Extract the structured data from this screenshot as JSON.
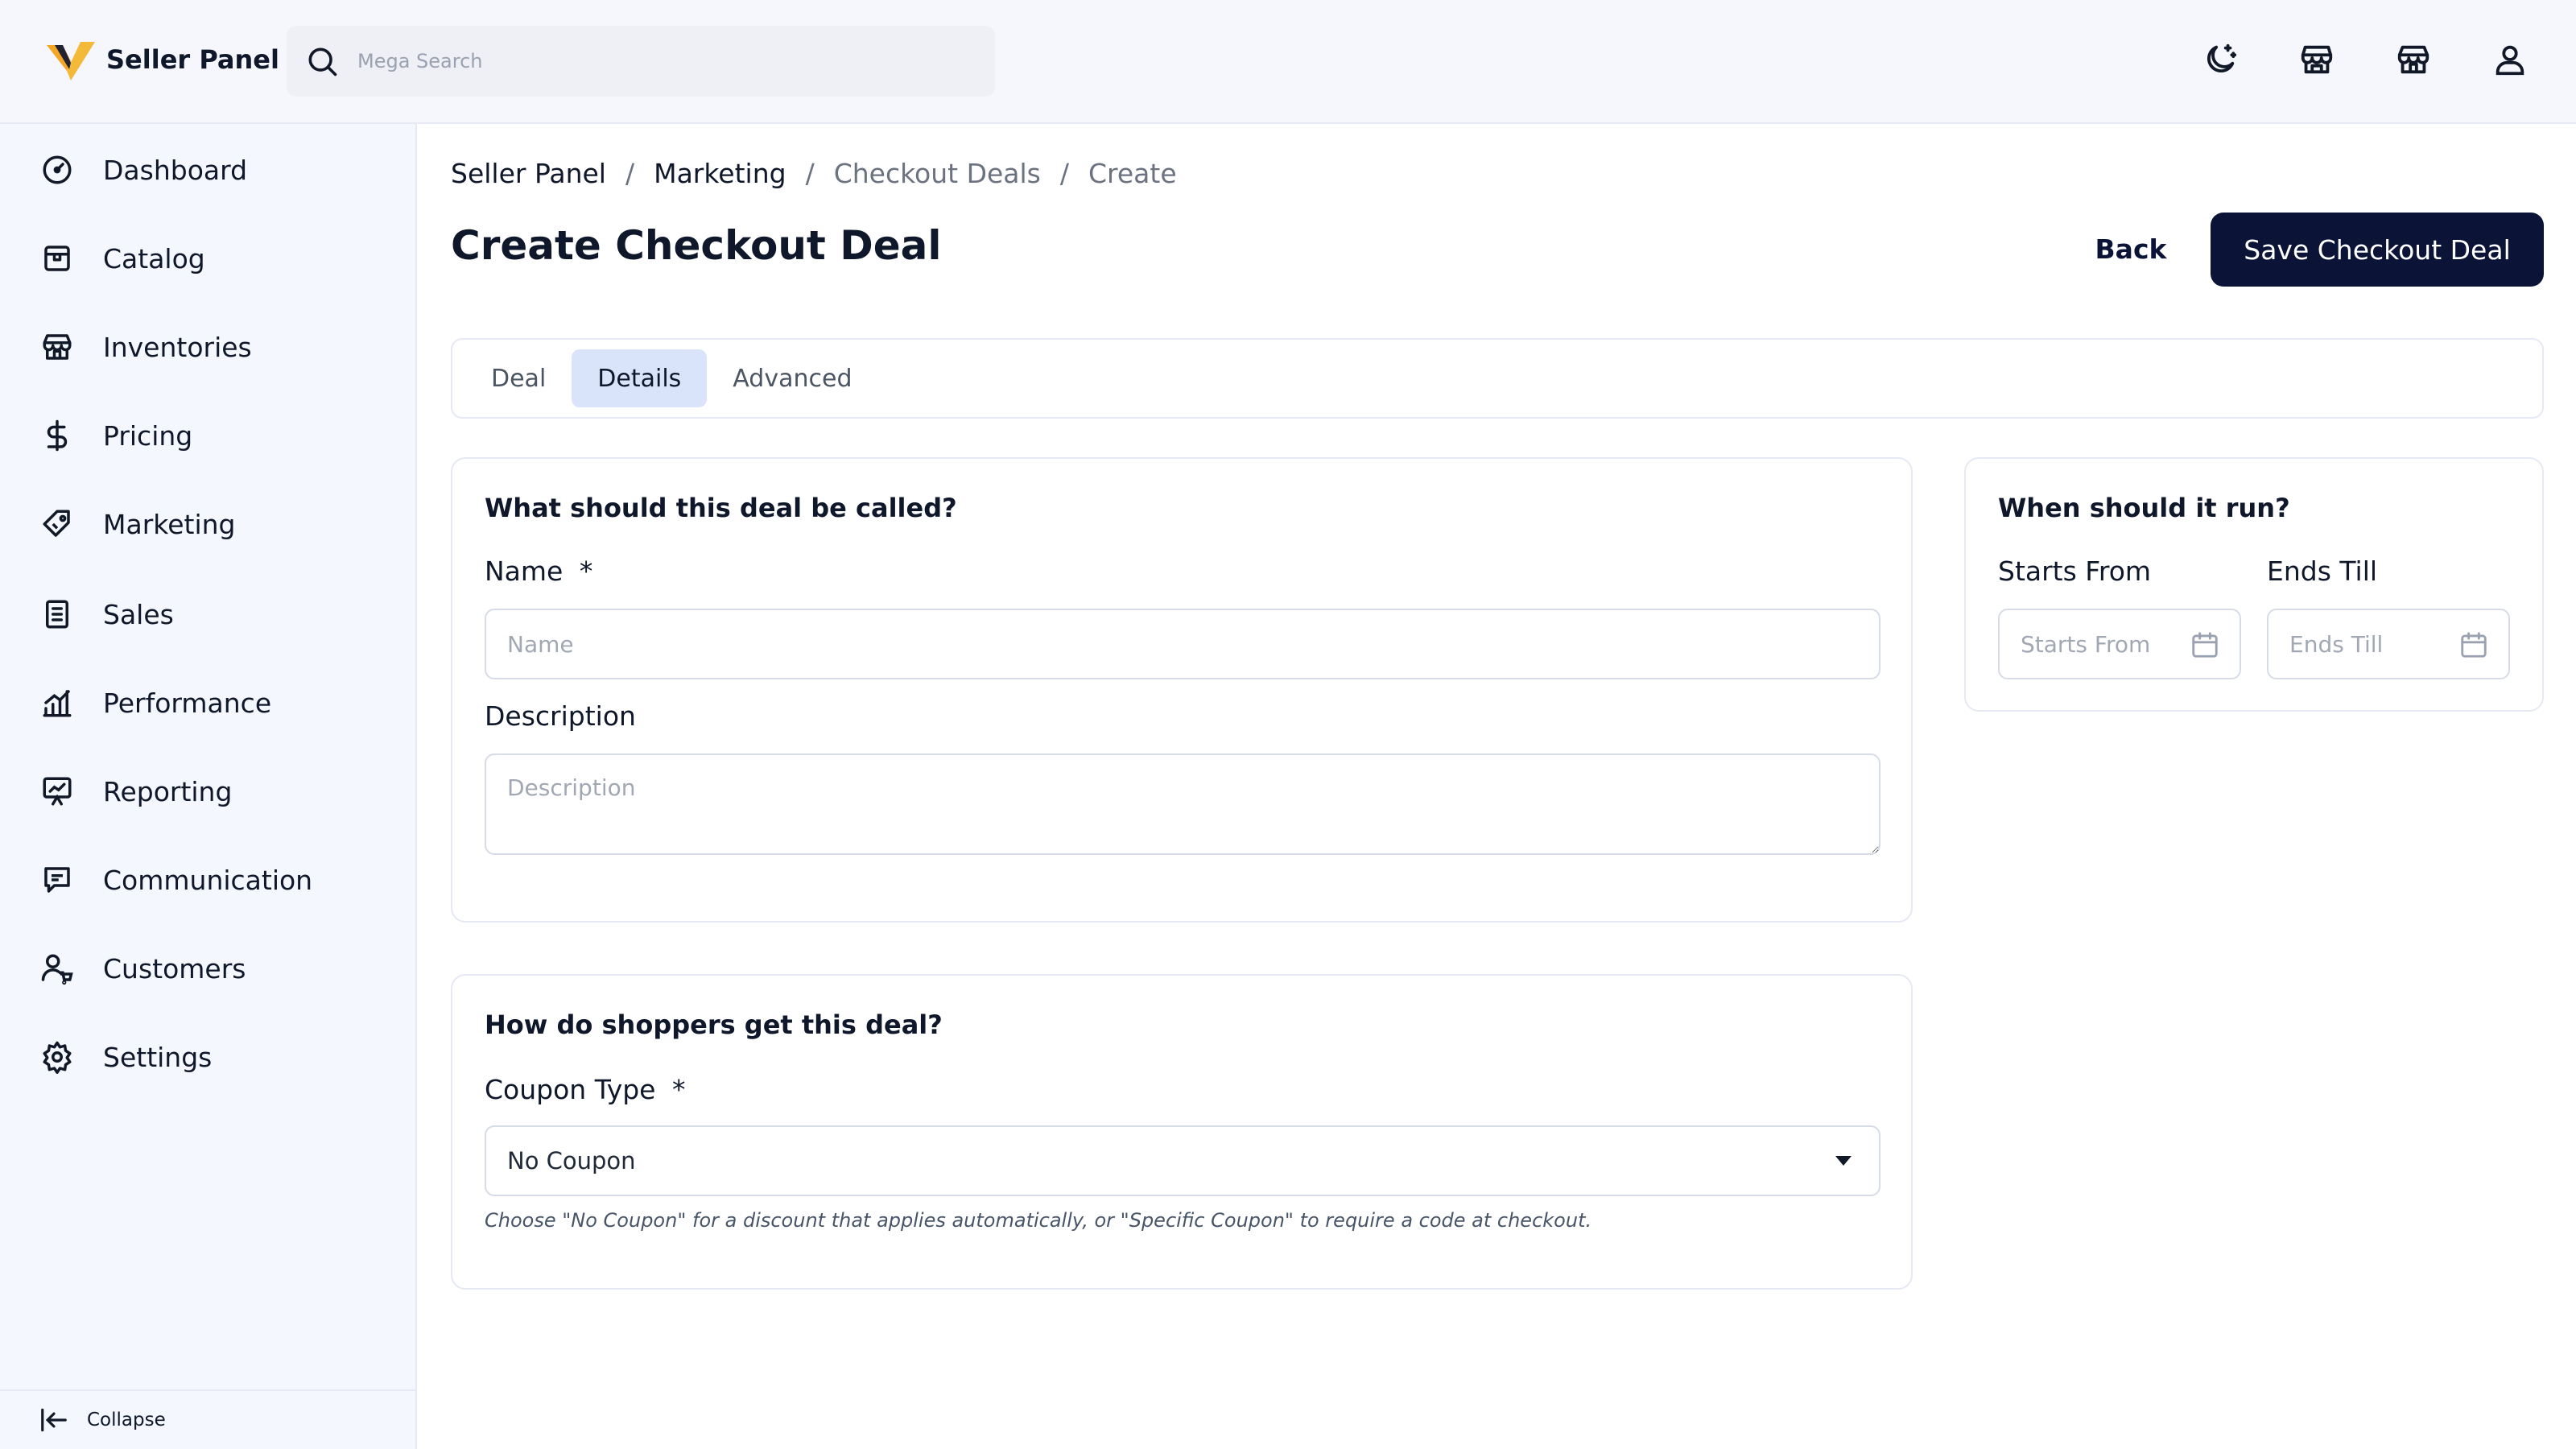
{
  "app": {
    "name": "Seller Panel",
    "search_placeholder": "Mega Search"
  },
  "topbar_icons": [
    "theme-toggle-icon",
    "store-icon",
    "warehouse-icon",
    "user-icon"
  ],
  "sidebar": {
    "items": [
      {
        "label": "Dashboard",
        "icon": "dashboard-icon"
      },
      {
        "label": "Catalog",
        "icon": "catalog-icon"
      },
      {
        "label": "Inventories",
        "icon": "inventories-icon"
      },
      {
        "label": "Pricing",
        "icon": "dollar-icon"
      },
      {
        "label": "Marketing",
        "icon": "tag-icon"
      },
      {
        "label": "Sales",
        "icon": "receipt-icon"
      },
      {
        "label": "Performance",
        "icon": "bar-chart-icon"
      },
      {
        "label": "Reporting",
        "icon": "presentation-icon"
      },
      {
        "label": "Communication",
        "icon": "message-icon"
      },
      {
        "label": "Customers",
        "icon": "customers-icon"
      },
      {
        "label": "Settings",
        "icon": "gear-icon"
      }
    ],
    "collapse_label": "Collapse"
  },
  "breadcrumb": [
    "Seller Panel",
    "Marketing",
    "Checkout Deals",
    "Create"
  ],
  "page": {
    "title": "Create Checkout Deal",
    "back_label": "Back",
    "save_label": "Save Checkout Deal"
  },
  "tabs": [
    {
      "label": "Deal",
      "active": false
    },
    {
      "label": "Details",
      "active": true
    },
    {
      "label": "Advanced",
      "active": false
    }
  ],
  "name_card": {
    "title": "What should this deal be called?",
    "name_label": "Name",
    "required_mark": "*",
    "name_placeholder": "Name",
    "name_value": "",
    "description_label": "Description",
    "description_placeholder": "Description",
    "description_value": ""
  },
  "coupon_card": {
    "title": "How do shoppers get this deal?",
    "coupon_label": "Coupon Type",
    "required_mark": "*",
    "coupon_value": "No Coupon",
    "help": "Choose \"No Coupon\" for a discount that applies automatically, or \"Specific Coupon\" to require a code at checkout."
  },
  "schedule_card": {
    "title": "When should it run?",
    "start_label": "Starts From",
    "start_placeholder": "Starts From",
    "end_label": "Ends Till",
    "end_placeholder": "Ends Till"
  },
  "colors": {
    "primary": "#0b1437",
    "accent": "#f5a623",
    "tab_active_bg": "#d9e4fb",
    "sidebar_bg": "#f4f7fd"
  }
}
